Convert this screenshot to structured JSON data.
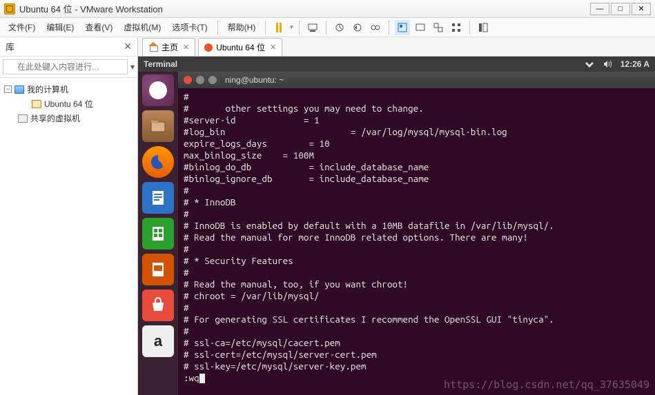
{
  "window": {
    "title": "Ubuntu 64 位 - VMware Workstation"
  },
  "menubar": {
    "file": "文件(F)",
    "edit": "编辑(E)",
    "view": "查看(V)",
    "vm": "虚拟机(M)",
    "tabs": "选项卡(T)",
    "help": "帮助(H)"
  },
  "sidebar": {
    "title": "库",
    "search_placeholder": "在此处键入内容进行...",
    "tree": {
      "root": "我的计算机",
      "vm1": "Ubuntu 64 位",
      "shared": "共享的虚拟机"
    }
  },
  "tabs": {
    "home": "主页",
    "vm": "Ubuntu 64 位"
  },
  "ubuntu_panel": {
    "app": "Terminal",
    "time": "12:26 A"
  },
  "terminal": {
    "title": "ning@ubuntu: ~",
    "lines": [
      "#",
      "#       other settings you may need to change.",
      "#server-id             = 1",
      "#log_bin                        = /var/log/mysql/mysql-bin.log",
      "expire_logs_days        = 10",
      "max_binlog_size    = 100M",
      "#binlog_do_db           = include_database_name",
      "#binlog_ignore_db       = include_database_name",
      "#",
      "# * InnoDB",
      "#",
      "# InnoDB is enabled by default with a 10MB datafile in /var/lib/mysql/.",
      "# Read the manual for more InnoDB related options. There are many!",
      "#",
      "# * Security Features",
      "#",
      "# Read the manual, too, if you want chroot!",
      "# chroot = /var/lib/mysql/",
      "#",
      "# For generating SSL certificates I recommend the OpenSSL GUI \"tinyca\".",
      "#",
      "# ssl-ca=/etc/mysql/cacert.pem",
      "# ssl-cert=/etc/mysql/server-cert.pem",
      "# ssl-key=/etc/mysql/server-key.pem"
    ],
    "command": ":wq"
  },
  "watermark": "https://blog.csdn.net/qq_37635049"
}
